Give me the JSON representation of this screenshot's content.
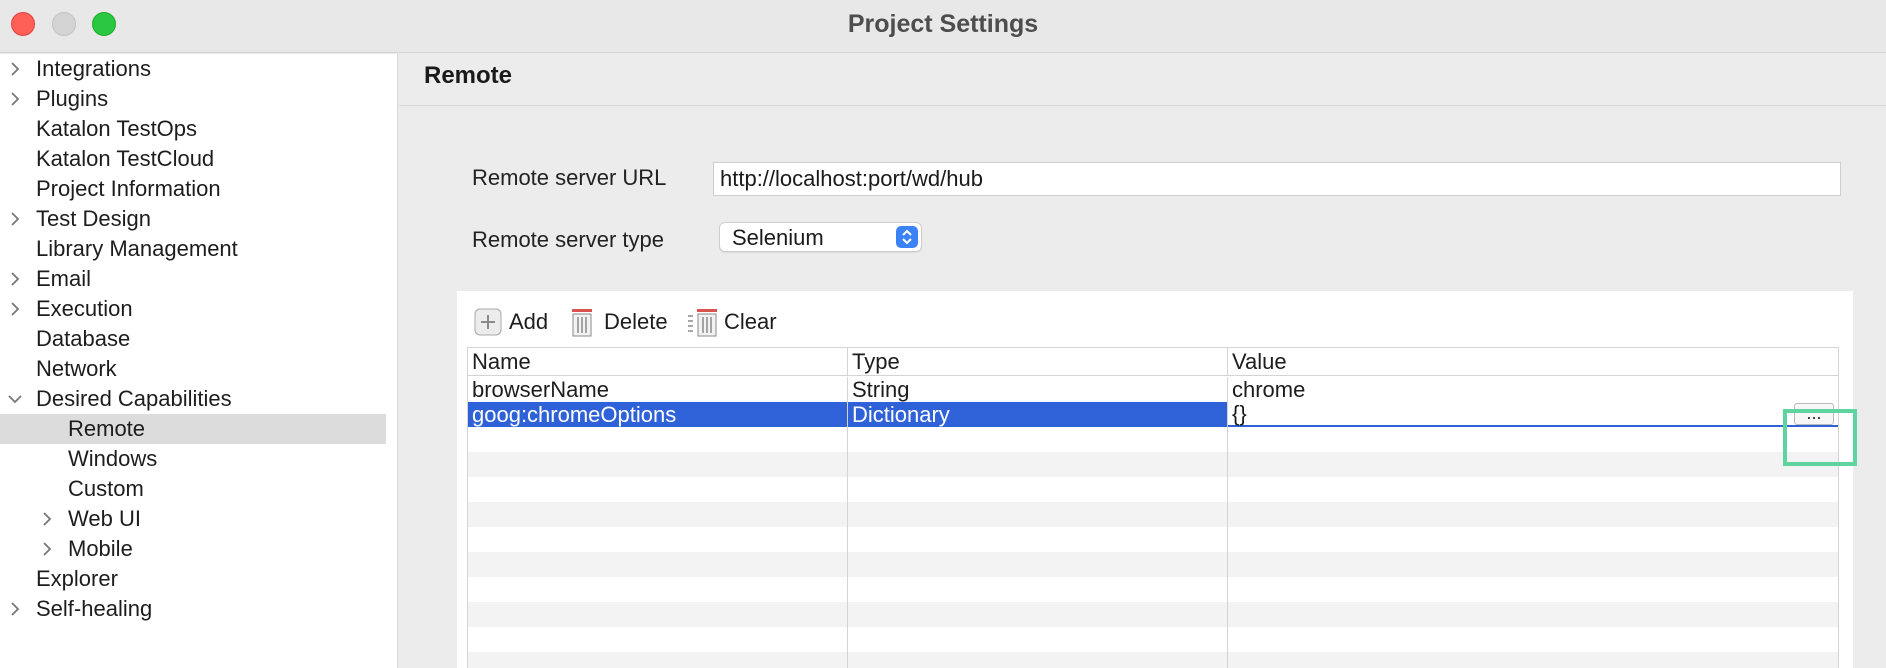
{
  "window": {
    "title": "Project Settings"
  },
  "sidebar": {
    "items": [
      {
        "label": "Integrations",
        "expander": "collapsed",
        "level": 0
      },
      {
        "label": "Plugins",
        "expander": "collapsed",
        "level": 0
      },
      {
        "label": "Katalon TestOps",
        "expander": "none",
        "level": 0
      },
      {
        "label": "Katalon TestCloud",
        "expander": "none",
        "level": 0
      },
      {
        "label": "Project Information",
        "expander": "none",
        "level": 0
      },
      {
        "label": "Test Design",
        "expander": "collapsed",
        "level": 0
      },
      {
        "label": "Library Management",
        "expander": "none",
        "level": 0
      },
      {
        "label": "Email",
        "expander": "collapsed",
        "level": 0
      },
      {
        "label": "Execution",
        "expander": "collapsed",
        "level": 0
      },
      {
        "label": "Database",
        "expander": "none",
        "level": 0
      },
      {
        "label": "Network",
        "expander": "none",
        "level": 0
      },
      {
        "label": "Desired Capabilities",
        "expander": "expanded",
        "level": 0
      },
      {
        "label": "Remote",
        "expander": "none",
        "level": 1,
        "selected": true
      },
      {
        "label": "Windows",
        "expander": "none",
        "level": 1
      },
      {
        "label": "Custom",
        "expander": "none",
        "level": 1
      },
      {
        "label": "Web UI",
        "expander": "collapsed",
        "level": 1
      },
      {
        "label": "Mobile",
        "expander": "collapsed",
        "level": 1
      },
      {
        "label": "Explorer",
        "expander": "none",
        "level": 0
      },
      {
        "label": "Self-healing",
        "expander": "collapsed",
        "level": 0
      }
    ]
  },
  "panel": {
    "title": "Remote",
    "remote_url": {
      "label": "Remote server URL",
      "value": "http://localhost:port/wd/hub"
    },
    "server_type": {
      "label": "Remote server type",
      "value": "Selenium"
    }
  },
  "toolbar": {
    "add_label": "Add",
    "delete_label": "Delete",
    "clear_label": "Clear"
  },
  "table": {
    "columns": [
      "Name",
      "Type",
      "Value"
    ],
    "rows": [
      {
        "name": "browserName",
        "type": "String",
        "value": "chrome"
      },
      {
        "name": "goog:chromeOptions",
        "type": "Dictionary",
        "value": "{}",
        "selected": true,
        "editing": true
      }
    ],
    "edit_button_label": "..."
  },
  "colors": {
    "selection": "#2f62d8",
    "highlight": "#5fd3a0",
    "select_accent": "#3b82f6"
  }
}
